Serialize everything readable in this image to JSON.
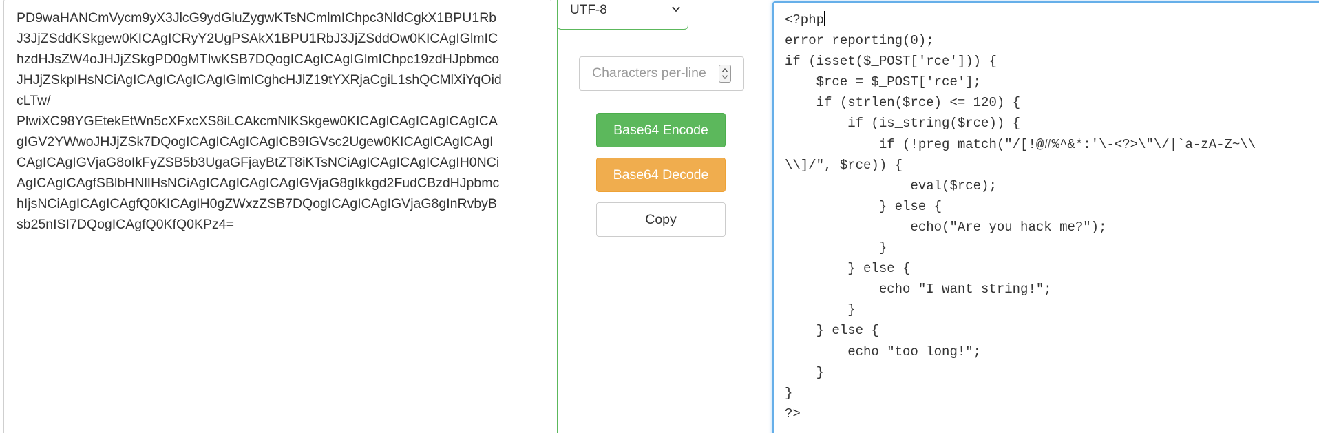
{
  "encoder": {
    "encoded_text": "PD9waHANCmVycm9yX3JlcG9ydGluZygwKTsNCmlmIChpc3NldCgkX1BPU1Rb\nJ3JjZSddKSkgew0KICAgICRyY2UgPSAkX1BPU1RbJ3JjZSddOw0KICAgIGlmIC\nhzdHJsZW4oJHJjZSkgPD0gMTIwKSB7DQogICAgICAgIGlmIChpc19zdHJpbmco\nJHJjZSkpIHsNCiAgICAgICAgICAgIGlmICghcHJlZ19tYXRjaCgiL1shQCMlXiYqOid\ncLTw/\nPlwiXC98YGEtekEtWn5cXFxcXS8iLCAkcmNlKSkgew0KICAgICAgICAgICAgICA\ngIGV2YWwoJHJjZSk7DQogICAgICAgICAgICB9IGVsc2Ugew0KICAgICAgICAgI\nCAgICAgIGVjaG8oIkFyZSB5b3UgaGFjayBtZT8iKTsNCiAgICAgICAgICAgIH0NCi\nAgICAgICAgfSBlbHNlIHsNCiAgICAgICAgICAgIGVjaG8gIkkgd2FudCBzdHJpbmc\nhIjsNCiAgICAgICAgfQ0KICAgIH0gZWxzZSB7DQogICAgICAgIGVjaG8gInRvbyB\nsb25nISI7DQogICAgfQ0KfQ0KPz4=",
    "charset": "UTF-8",
    "chars_per_line_placeholder": "Characters per-line",
    "encode_label": "Base64 Encode",
    "decode_label": "Base64 Decode",
    "copy_label": "Copy",
    "decoded_text_first": "<?php",
    "decoded_text_rest": "\nerror_reporting(0);\nif (isset($_POST['rce'])) {\n    $rce = $_POST['rce'];\n    if (strlen($rce) <= 120) {\n        if (is_string($rce)) {\n            if (!preg_match(\"/[!@#%^&*:'\\-<?>\\\"\\/|`a-zA-Z~\\\\\n\\\\]/\", $rce)) {\n                eval($rce);\n            } else {\n                echo(\"Are you hack me?\");\n            }\n        } else {\n            echo \"I want string!\";\n        }\n    } else {\n        echo \"too long!\";\n    }\n}\n?>"
  },
  "colors": {
    "encode_button": "#5cb85c",
    "decode_button": "#f0ad4e",
    "focus_border": "#66afe9"
  },
  "icons": {
    "select_arrow": "chevron-down-icon",
    "number_spinner": "spinner-icon"
  }
}
